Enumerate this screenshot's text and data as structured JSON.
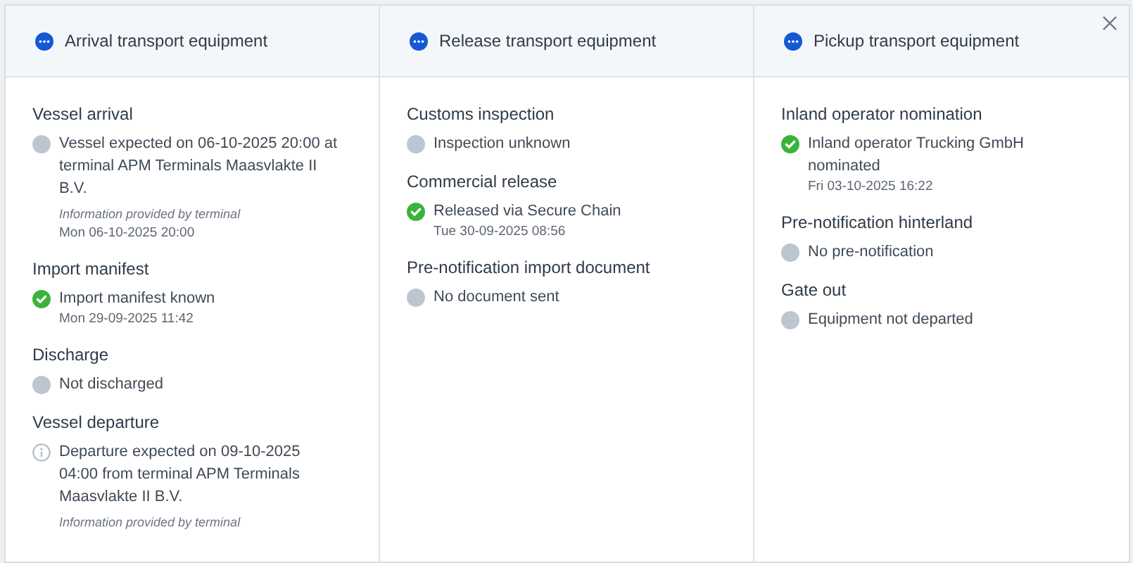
{
  "columns": [
    {
      "title": "Arrival transport equipment",
      "sections": [
        {
          "heading": "Vessel arrival",
          "kind": "pending",
          "text": "Vessel expected on 06-10-2025 20:00 at terminal APM Terminals Maasvlakte II B.V.",
          "note": "Information provided by terminal",
          "time": "Mon 06-10-2025 20:00"
        },
        {
          "heading": "Import manifest",
          "kind": "done",
          "text": "Import manifest known",
          "time": "Mon 29-09-2025 11:42"
        },
        {
          "heading": "Discharge",
          "kind": "pending",
          "text": "Not discharged"
        },
        {
          "heading": "Vessel departure",
          "kind": "info",
          "text": "Departure expected on 09-10-2025 04:00 from terminal APM Terminals Maasvlakte II B.V.",
          "note": "Information provided by terminal"
        }
      ]
    },
    {
      "title": "Release transport equipment",
      "sections": [
        {
          "heading": "Customs inspection",
          "kind": "pending",
          "text": "Inspection unknown"
        },
        {
          "heading": "Commercial release",
          "kind": "done",
          "text": "Released via Secure Chain",
          "time": "Tue 30-09-2025 08:56"
        },
        {
          "heading": "Pre-notification import document",
          "kind": "pending",
          "text": "No document sent"
        }
      ]
    },
    {
      "title": "Pickup transport equipment",
      "sections": [
        {
          "heading": "Inland operator nomination",
          "kind": "done",
          "text": "Inland operator Trucking GmbH nominated",
          "time": "Fri 03-10-2025 16:22"
        },
        {
          "heading": "Pre-notification hinterland",
          "kind": "pending",
          "text": "No pre-notification"
        },
        {
          "heading": "Gate out",
          "kind": "pending",
          "text": "Equipment not departed"
        }
      ]
    }
  ]
}
